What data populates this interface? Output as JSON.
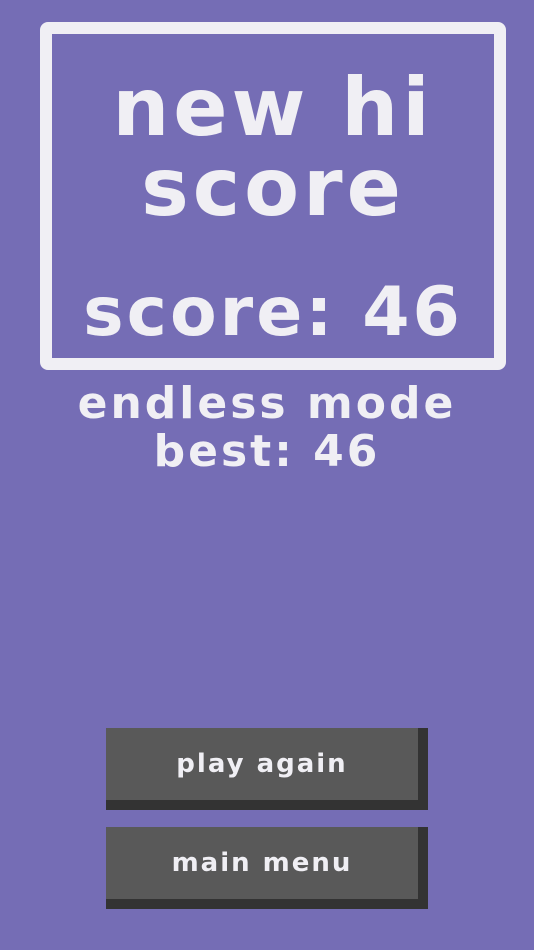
{
  "result_panel": {
    "title": "new hi score",
    "score_text": "score: 46"
  },
  "mode_info": {
    "mode": "endless mode",
    "best_text": "best: 46"
  },
  "buttons": {
    "play_again": "play again",
    "main_menu": "main menu"
  },
  "colors": {
    "background": "#756db5",
    "text": "#f0eff4",
    "button_face": "#595959",
    "button_shadow": "#333333"
  }
}
